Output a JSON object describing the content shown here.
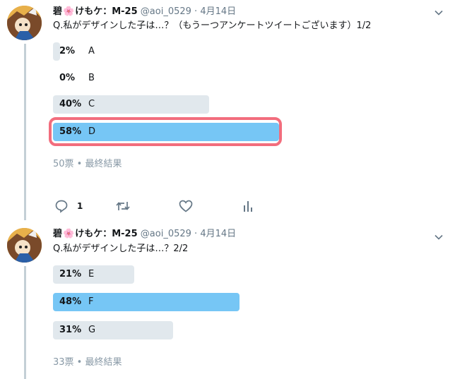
{
  "tweets": [
    {
      "user": {
        "name_prefix": "碧",
        "name_suffix": "けもケ：M-25",
        "handle": "@aoi_0529",
        "separator": "·",
        "date": "4月14日"
      },
      "text": "Q.私がデザインした子は…？（もうーつアンケートツイートございます）1/2",
      "poll": {
        "options": [
          {
            "percent": "2%",
            "value": 2,
            "label": "A",
            "winner": false
          },
          {
            "percent": "0%",
            "value": 0,
            "label": "B",
            "winner": false
          },
          {
            "percent": "40%",
            "value": 40,
            "label": "C",
            "winner": false
          },
          {
            "percent": "58%",
            "value": 58,
            "label": "D",
            "winner": true
          }
        ],
        "meta": "50票 • 最終結果"
      },
      "actions": {
        "reply_count": "1"
      }
    },
    {
      "user": {
        "name_prefix": "碧",
        "name_suffix": "けもケ：M-25",
        "handle": "@aoi_0529",
        "separator": "·",
        "date": "4月14日"
      },
      "text": "Q.私がデザインした子は…？2/2",
      "poll": {
        "options": [
          {
            "percent": "21%",
            "value": 21,
            "label": "E",
            "winner": false
          },
          {
            "percent": "48%",
            "value": 48,
            "label": "F",
            "winner": true
          },
          {
            "percent": "31%",
            "value": 31,
            "label": "G",
            "winner": false
          }
        ],
        "meta": "33票 • 最終結果"
      }
    }
  ],
  "colors": {
    "winner_bar": "#76c6f5",
    "bar": "#e1e8ed",
    "highlight": "#f26d7d",
    "thread_line": "#c4cfd6"
  },
  "icons": {
    "flower": "🌸",
    "reply": "reply-icon",
    "retweet": "retweet-icon",
    "like": "heart-icon",
    "analytics": "analytics-icon",
    "menu": "chevron-down-icon"
  }
}
